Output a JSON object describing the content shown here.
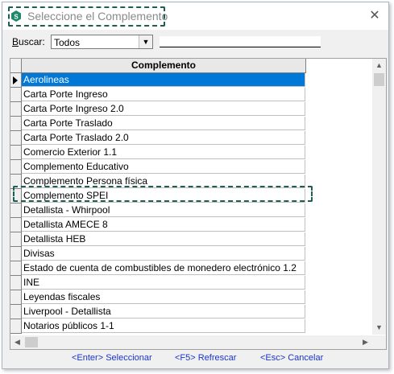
{
  "window": {
    "title": "Seleccione el Complemento",
    "close_glyph": "✕"
  },
  "search": {
    "label_prefix": "B",
    "label_rest": "uscar:",
    "filter_value": "Todos",
    "text_value": ""
  },
  "grid": {
    "column_header": "Complemento",
    "selected_index": 0,
    "highlighted_index": 4,
    "rows": [
      "Aerolineas",
      "Carta Porte Ingreso",
      "Carta Porte Ingreso 2.0",
      "Carta Porte Traslado",
      "Carta Porte Traslado 2.0",
      "Comercio Exterior 1.1",
      "Complemento Educativo",
      "Complemento Persona física",
      "Complemento SPEI",
      "Detallista - Whirpool",
      "Detallista AMECE 8",
      "Detallista HEB",
      "Divisas",
      "Estado de cuenta de combustibles de monedero electrónico 1.2",
      "INE",
      "Leyendas fiscales",
      "Liverpool - Detallista",
      "Notarios públicos 1-1"
    ]
  },
  "footer": {
    "select": "<Enter> Seleccionar",
    "refresh": "<F5> Refrescar",
    "cancel": "<Esc> Cancelar"
  },
  "colors": {
    "selection": "#0078d7",
    "highlight_border": "#1f5f53",
    "link": "#1a35c8"
  }
}
